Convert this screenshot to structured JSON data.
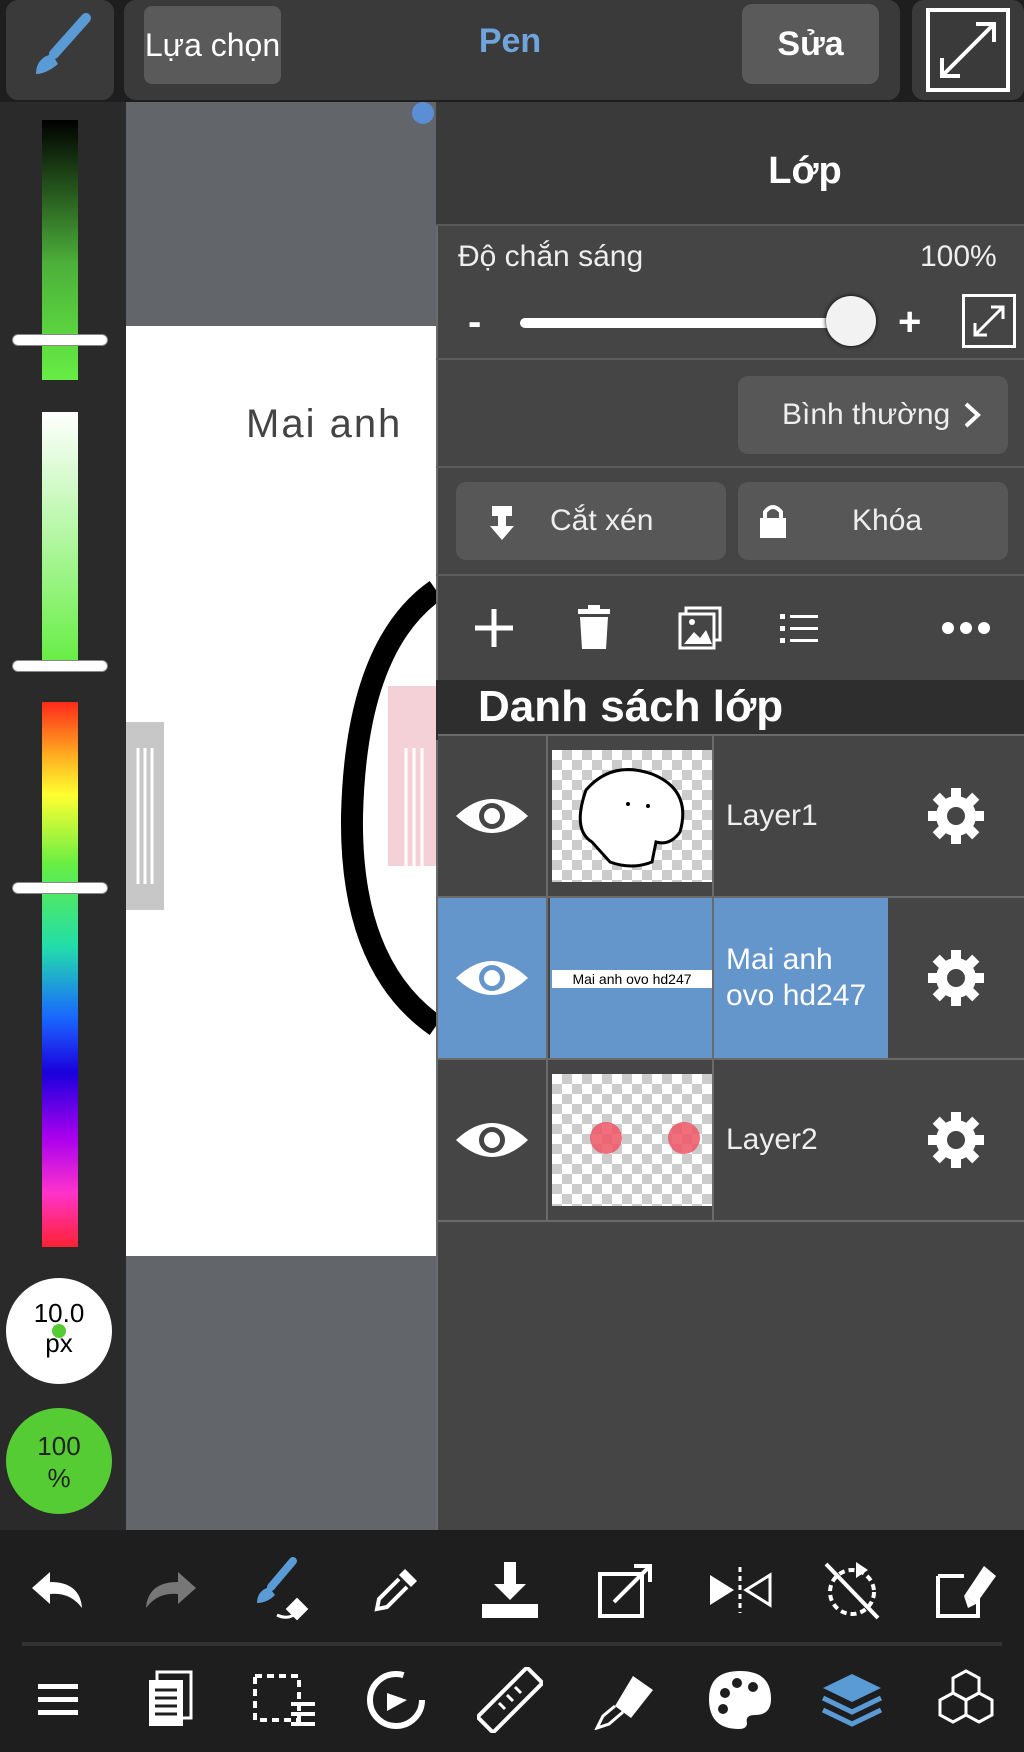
{
  "topbar": {
    "selection_label": "Lựa chọn",
    "tool_name": "Pen",
    "edit_label": "Sửa"
  },
  "brush": {
    "size_value": "10.0",
    "size_unit": "px",
    "opacity_value": "100",
    "opacity_unit": "%"
  },
  "canvas": {
    "visible_text": "Mai anh"
  },
  "layer_panel": {
    "title": "Lớp",
    "opacity_label": "Độ chắn sáng",
    "opacity_value": "100%",
    "opacity_level": 1.0,
    "minus_label": "-",
    "plus_label": "+",
    "blend_mode": "Bình thường",
    "clipping_label": "Cắt xén",
    "lock_label": "Khóa",
    "list_title": "Danh sách lớp",
    "layers": [
      {
        "name": "Layer1",
        "visible": true,
        "selected": false
      },
      {
        "name": "Mai anh ovo hd247",
        "visible": true,
        "selected": true,
        "thumb_text": "Mai anh ovo hd247"
      },
      {
        "name": "Layer2",
        "visible": true,
        "selected": false
      }
    ]
  },
  "colors": {
    "accent_blue": "#6496cc",
    "current_color": "#55cc33",
    "tool_blue": "#6fa4dc"
  },
  "icons": {
    "top": [
      "brush-icon",
      "fullscreen-icon"
    ],
    "panel_tools": [
      "add-layer-icon",
      "trash-icon",
      "image-layer-icon",
      "list-icon",
      "more-icon"
    ],
    "bottom_row1": [
      "undo-icon",
      "redo-icon",
      "brush-transform-icon",
      "eyedropper-icon",
      "download-icon",
      "transform-icon",
      "flip-icon",
      "rotate-reset-icon",
      "eraser-icon"
    ],
    "bottom_row2": [
      "menu-icon",
      "pages-icon",
      "selection-list-icon",
      "rotate-icon",
      "ruler-icon",
      "fill-icon",
      "palette-icon",
      "layers-icon",
      "materials-icon"
    ]
  }
}
